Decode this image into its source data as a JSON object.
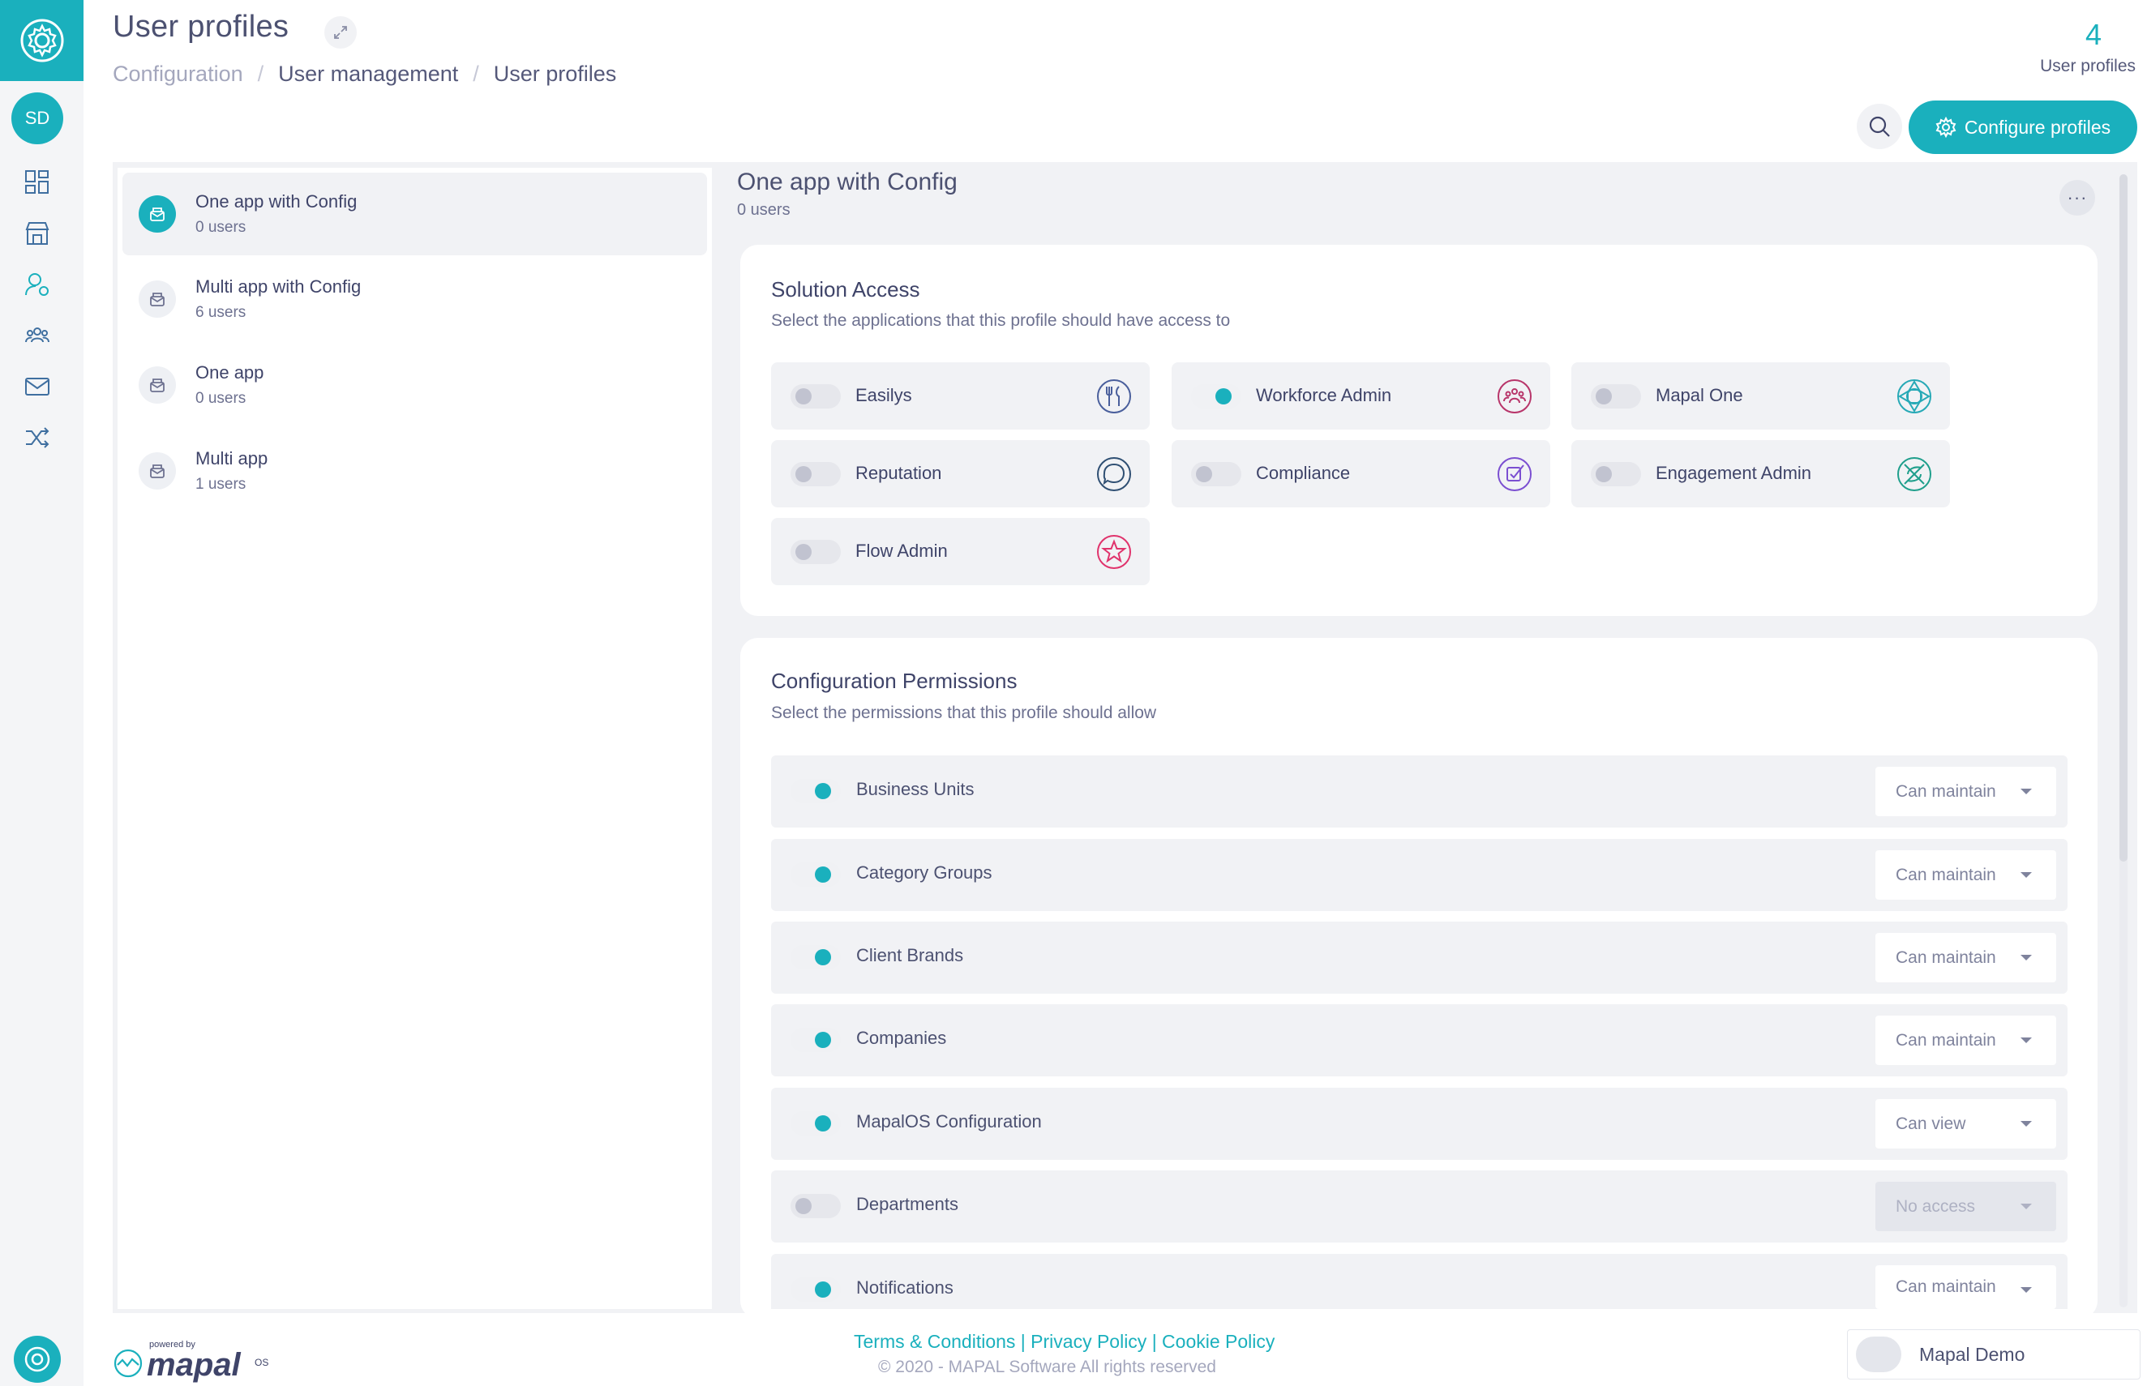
{
  "header": {
    "title": "User profiles",
    "breadcrumb": [
      "Configuration",
      "User management",
      "User profiles"
    ],
    "count": "4",
    "count_label": "User profiles",
    "configure_label": "Configure profiles"
  },
  "user": {
    "initials": "SD",
    "name": "Mapal Demo"
  },
  "profiles": [
    {
      "name": "One app with Config",
      "users": "0 users",
      "selected": true
    },
    {
      "name": "Multi app with Config",
      "users": "6 users",
      "selected": false
    },
    {
      "name": "One app",
      "users": "0 users",
      "selected": false
    },
    {
      "name": "Multi app",
      "users": "1 users",
      "selected": false
    }
  ],
  "detail": {
    "title": "One app with Config",
    "users": "0 users",
    "more": "···"
  },
  "solution_access": {
    "title": "Solution Access",
    "subtitle": "Select the applications that this profile should have access to",
    "apps": [
      {
        "name": "Easilys",
        "enabled": false,
        "icon": "cutlery-icon",
        "color": "#4a5f9c"
      },
      {
        "name": "Workforce Admin",
        "enabled": true,
        "icon": "team-icon",
        "color": "#b8356a"
      },
      {
        "name": "Mapal One",
        "enabled": false,
        "icon": "lifebuoy-icon",
        "color": "#27a9b6"
      },
      {
        "name": "Reputation",
        "enabled": false,
        "icon": "speech-bubble-icon",
        "color": "#2f4f73"
      },
      {
        "name": "Compliance",
        "enabled": false,
        "icon": "checkbox-icon",
        "color": "#7b4fd1"
      },
      {
        "name": "Engagement Admin",
        "enabled": false,
        "icon": "compass-icon",
        "color": "#1f9f8c"
      },
      {
        "name": "Flow Admin",
        "enabled": false,
        "icon": "star-icon",
        "color": "#e0336c"
      }
    ]
  },
  "configuration_permissions": {
    "title": "Configuration Permissions",
    "subtitle": "Select the permissions that this profile should allow",
    "items": [
      {
        "name": "Business Units",
        "enabled": true,
        "level": "Can maintain"
      },
      {
        "name": "Category Groups",
        "enabled": true,
        "level": "Can maintain"
      },
      {
        "name": "Client Brands",
        "enabled": true,
        "level": "Can maintain"
      },
      {
        "name": "Companies",
        "enabled": true,
        "level": "Can maintain"
      },
      {
        "name": "MapalOS Configuration",
        "enabled": true,
        "level": "Can view"
      },
      {
        "name": "Departments",
        "enabled": false,
        "level": "No access"
      },
      {
        "name": "Notifications",
        "enabled": true,
        "level": "Can maintain"
      }
    ]
  },
  "footer": {
    "links": "Terms & Conditions | Privacy Policy | Cookie Policy",
    "copyright": "© 2020 - MAPAL Software All rights reserved",
    "powered_by": "powered by",
    "brand": "mapal",
    "brand_suffix": "OS"
  },
  "colors": {
    "accent": "#1ab0bd",
    "text": "#3f4469",
    "panel": "#f1f2f5"
  }
}
